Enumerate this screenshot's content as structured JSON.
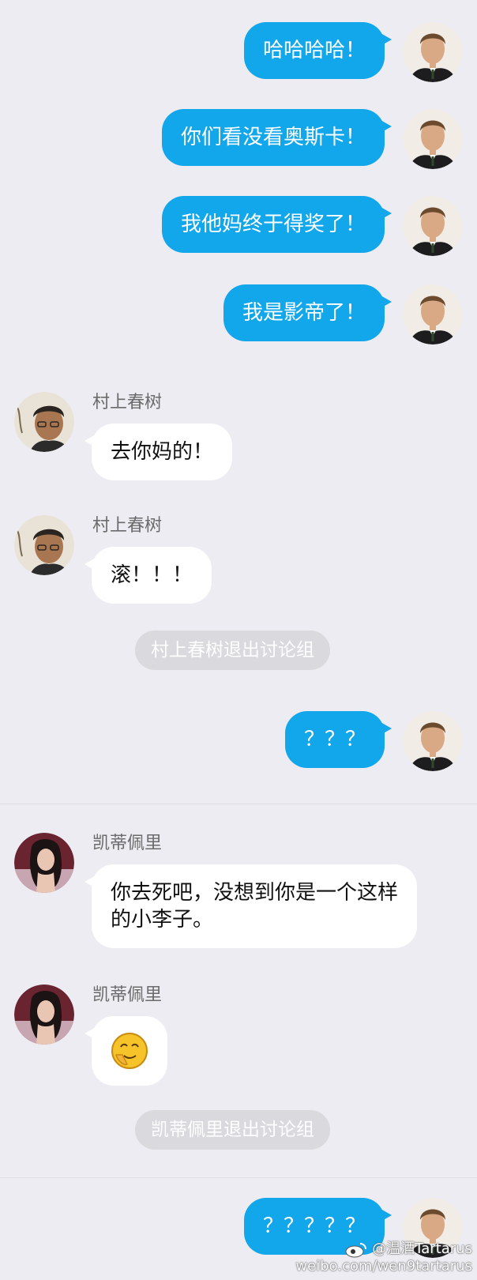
{
  "messages": [
    {
      "side": "me",
      "text": "哈哈哈哈！"
    },
    {
      "side": "me",
      "text": "你们看没看奥斯卡！"
    },
    {
      "side": "me",
      "text": "我他妈终于得奖了！"
    },
    {
      "side": "me",
      "text": "我是影帝了！"
    },
    {
      "side": "them",
      "sender": "村上春树",
      "text": "去你妈的！"
    },
    {
      "side": "them",
      "sender": "村上春树",
      "text": "滚！！！"
    },
    {
      "side": "system",
      "text": "村上春树退出讨论组"
    },
    {
      "side": "me",
      "text": "？？？"
    },
    {
      "side": "them",
      "sender": "凯蒂佩里",
      "text": "你去死吧，没想到你是一个这样的小李子。"
    },
    {
      "side": "them",
      "sender": "凯蒂佩里",
      "emoji": "smirk-emoji"
    },
    {
      "side": "system",
      "text": "凯蒂佩里退出讨论组"
    },
    {
      "side": "me",
      "text": "？？？？？"
    }
  ],
  "watermark": {
    "handle": "@温酒Tartarus",
    "url": "weibo.com/wen9tartarus",
    "icon": "weibo-icon"
  },
  "colors": {
    "background": "#ececf2",
    "my_bubble": "#12a6ea",
    "their_bubble": "#ffffff",
    "system_pill": "#d9d9de"
  },
  "icons": {
    "me_avatar": "leonardo-avatar",
    "murakami_avatar": "murakami-avatar",
    "katy_avatar": "katy-avatar"
  }
}
